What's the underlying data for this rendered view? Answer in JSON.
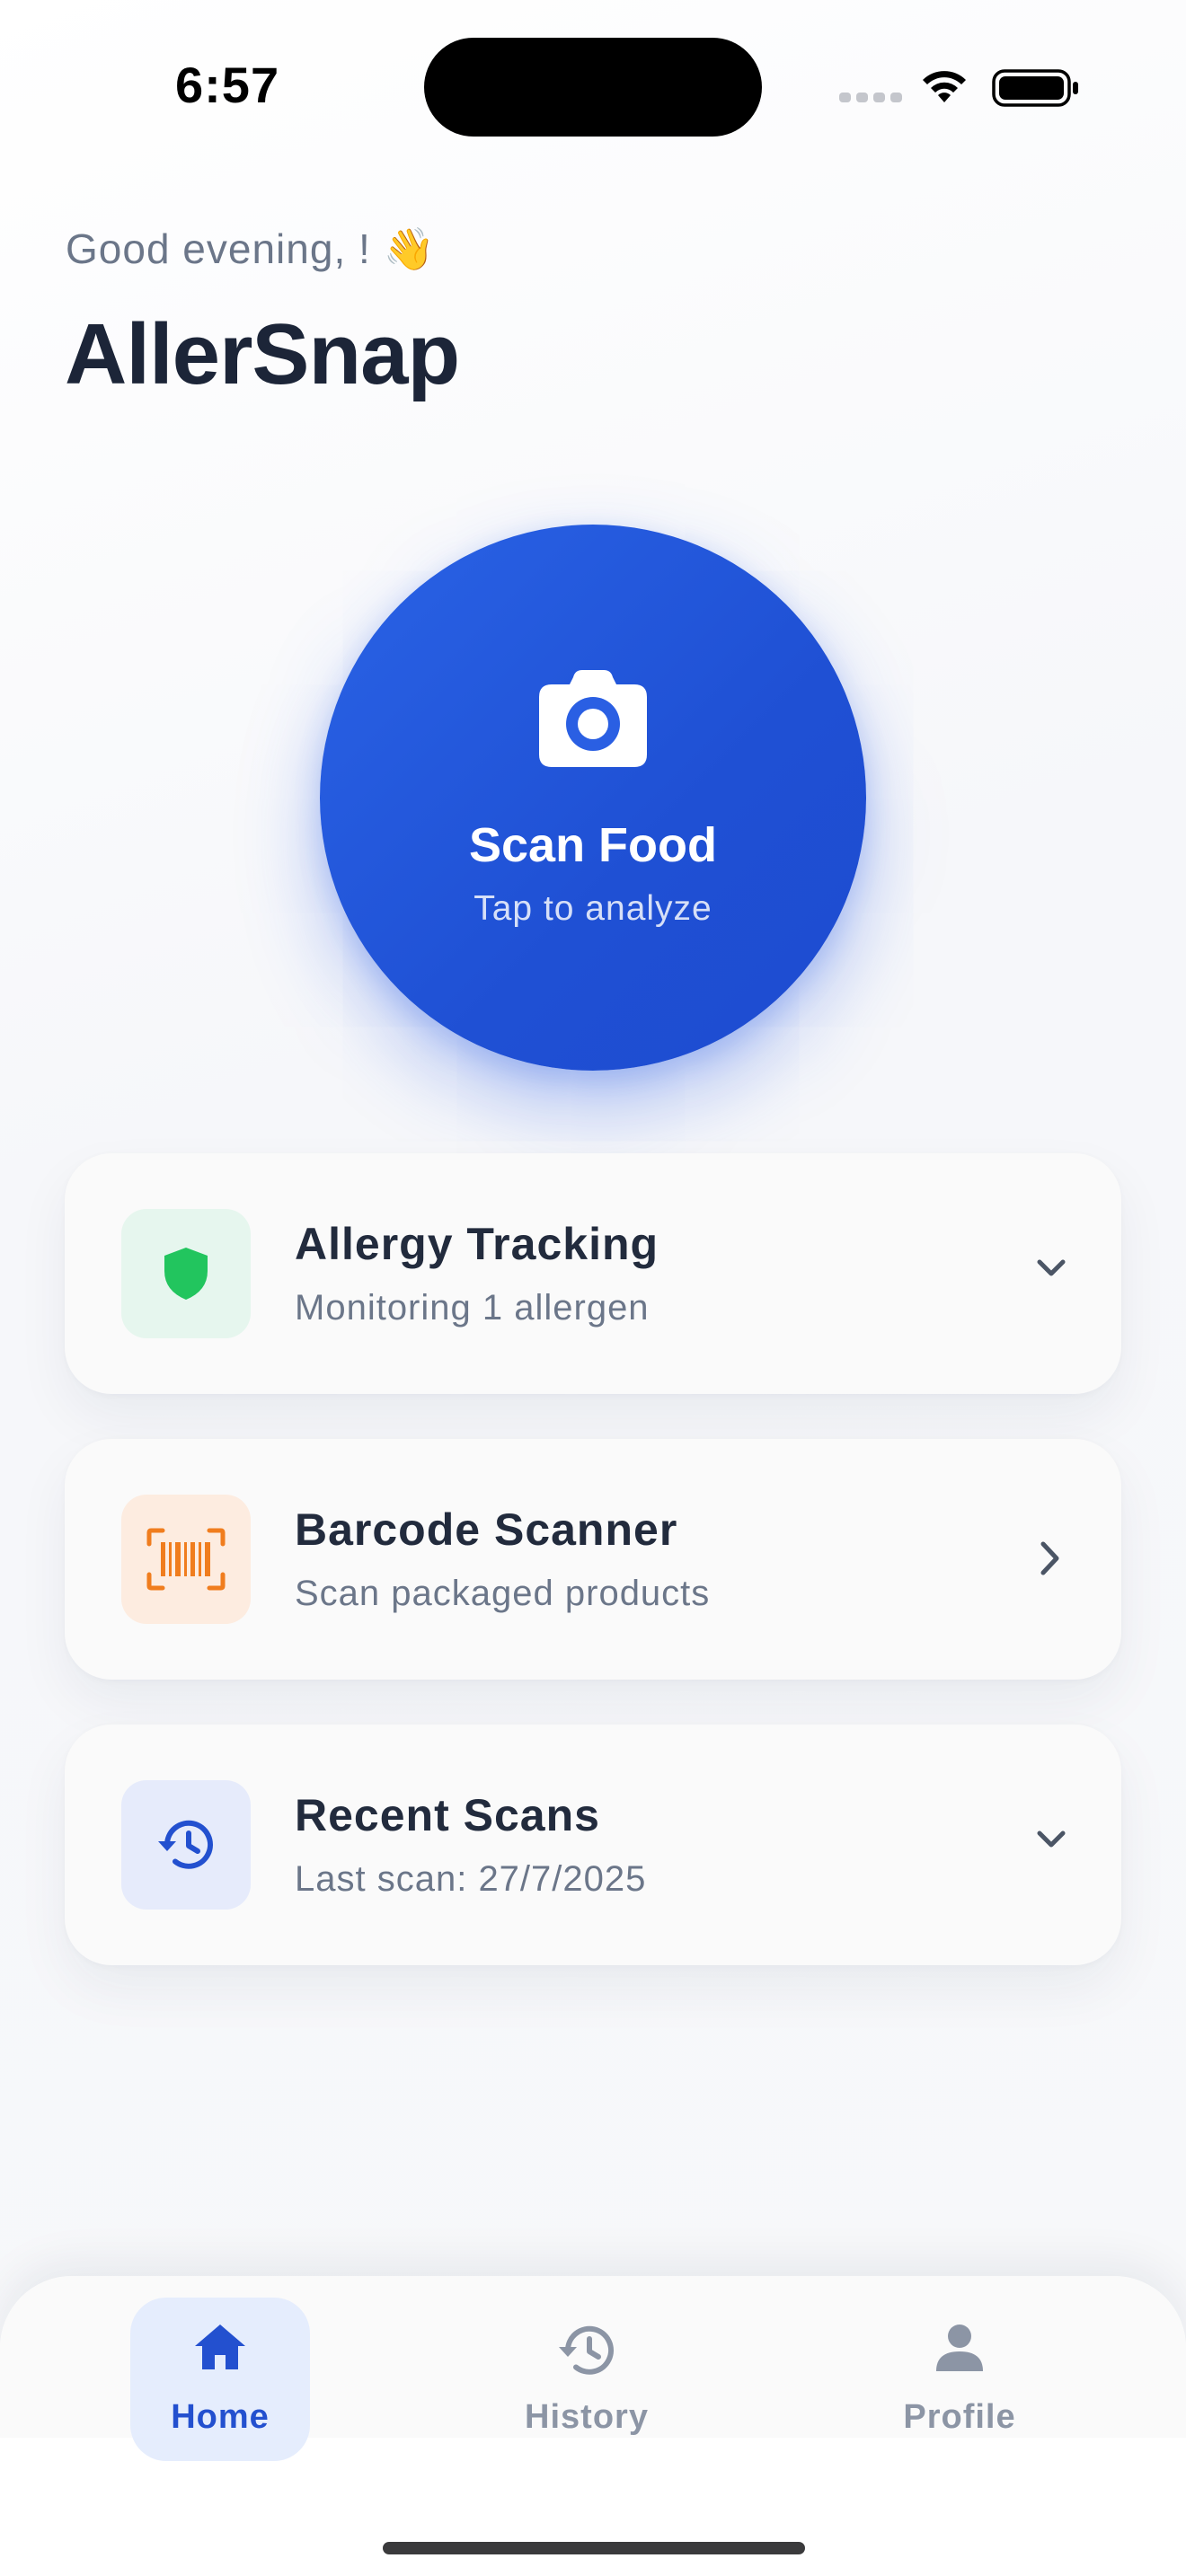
{
  "status_bar": {
    "time": "6:57"
  },
  "header": {
    "greeting": "Good evening, ! 👋",
    "title": "AllerSnap"
  },
  "scan_button": {
    "label": "Scan Food",
    "sublabel": "Tap to analyze",
    "icon": "camera-icon"
  },
  "cards": [
    {
      "title": "Allergy Tracking",
      "subtitle": "Monitoring 1 allergen",
      "icon": "shield-icon",
      "icon_color": "#22c55e",
      "icon_bg": "#e6f6ee",
      "chevron": "chevron-down-icon"
    },
    {
      "title": "Barcode Scanner",
      "subtitle": "Scan packaged products",
      "icon": "barcode-icon",
      "icon_color": "#f07d1e",
      "icon_bg": "#fdece0",
      "chevron": "chevron-right-icon"
    },
    {
      "title": "Recent Scans",
      "subtitle": "Last scan: 27/7/2025",
      "icon": "history-icon",
      "icon_color": "#2350cf",
      "icon_bg": "#e6ebfb",
      "chevron": "chevron-down-icon"
    }
  ],
  "bottom_nav": {
    "items": [
      {
        "label": "Home",
        "icon": "home-icon",
        "active": true
      },
      {
        "label": "History",
        "icon": "history-icon",
        "active": false
      },
      {
        "label": "Profile",
        "icon": "user-icon",
        "active": false
      }
    ]
  },
  "colors": {
    "accent": "#2a5fe3",
    "text_primary": "#1c2538",
    "text_secondary": "#6b7689",
    "nav_inactive": "#8c95a5"
  }
}
